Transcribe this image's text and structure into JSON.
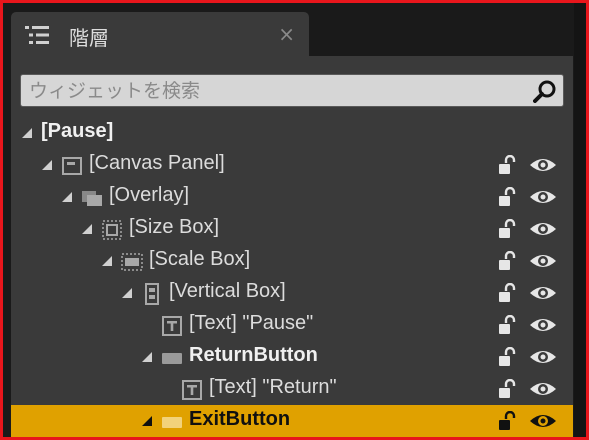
{
  "tab": {
    "title": "階層",
    "close": "×",
    "icon": "hierarchy-list-icon"
  },
  "search": {
    "placeholder": "ウィジェットを検索",
    "value": "",
    "icon": "search-icon"
  },
  "tree": [
    {
      "label": "[Pause]",
      "depth": 0,
      "bold": true,
      "icon": "none",
      "controls": false,
      "selected": false
    },
    {
      "label": "[Canvas Panel]",
      "depth": 1,
      "bold": false,
      "icon": "canvas-panel-icon",
      "controls": true,
      "selected": false
    },
    {
      "label": "[Overlay]",
      "depth": 2,
      "bold": false,
      "icon": "overlay-icon",
      "controls": true,
      "selected": false
    },
    {
      "label": "[Size Box]",
      "depth": 3,
      "bold": false,
      "icon": "size-box-icon",
      "controls": true,
      "selected": false
    },
    {
      "label": "[Scale Box]",
      "depth": 4,
      "bold": false,
      "icon": "scale-box-icon",
      "controls": true,
      "selected": false
    },
    {
      "label": "[Vertical Box]",
      "depth": 5,
      "bold": false,
      "icon": "vertical-box-icon",
      "controls": true,
      "selected": false
    },
    {
      "label": "[Text] \"Pause\"",
      "depth": 6,
      "bold": false,
      "icon": "text-icon",
      "controls": true,
      "selected": false,
      "leaf": true
    },
    {
      "label": "ReturnButton",
      "depth": 6,
      "bold": true,
      "icon": "button-icon",
      "controls": true,
      "selected": false
    },
    {
      "label": "[Text] \"Return\"",
      "depth": 7,
      "bold": false,
      "icon": "text-icon",
      "controls": true,
      "selected": false,
      "leaf": true
    },
    {
      "label": "ExitButton",
      "depth": 6,
      "bold": true,
      "icon": "button-icon",
      "controls": true,
      "selected": true
    }
  ],
  "colors": {
    "selection": "#e0a100",
    "panel": "#3a3a3a",
    "frame_border": "#e8161c"
  }
}
